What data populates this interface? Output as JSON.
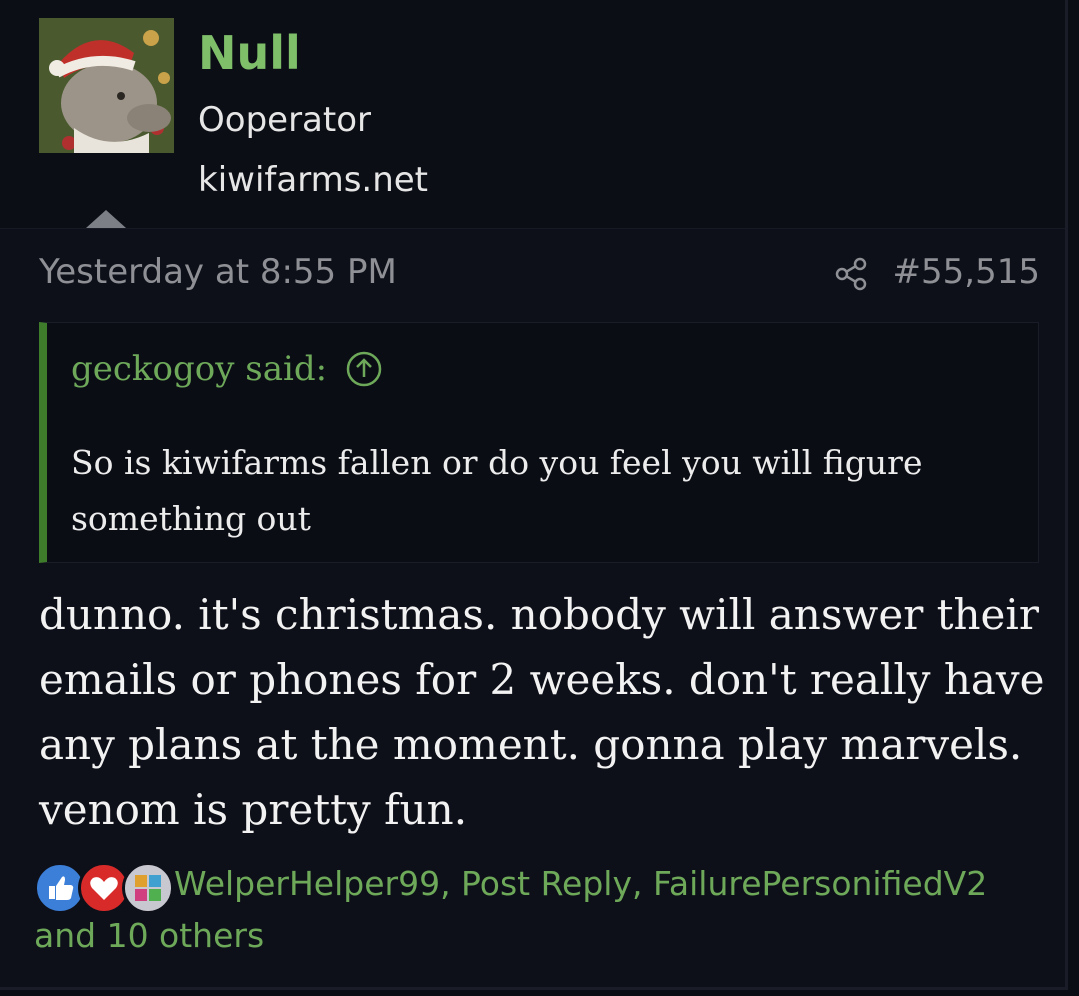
{
  "user": {
    "name": "Null",
    "title": "Ooperator",
    "extra": "kiwifarms.net"
  },
  "meta": {
    "timestamp": "Yesterday at 8:55 PM",
    "post_number": "#55,515"
  },
  "quote": {
    "attribution": "geckogoy said:",
    "text": "So is kiwifarms fallen or do you feel you will figure something out"
  },
  "body": {
    "text": "dunno. it's christmas. nobody will answer their emails or phones for 2 weeks. don't really have any plans at the moment. gonna play marvels. venom is pretty fun."
  },
  "reactions": {
    "icons": [
      "thumbs-up-icon",
      "heart-icon",
      "puzzle-icon"
    ],
    "users_text": "WelperHelper99, Post Reply, FailurePersonifiedV2 and 10 others"
  },
  "colors": {
    "username": "#7fbf6a",
    "quote_border": "#3e7b2a",
    "link_green": "#6ea95a",
    "background": "#0e1019"
  }
}
